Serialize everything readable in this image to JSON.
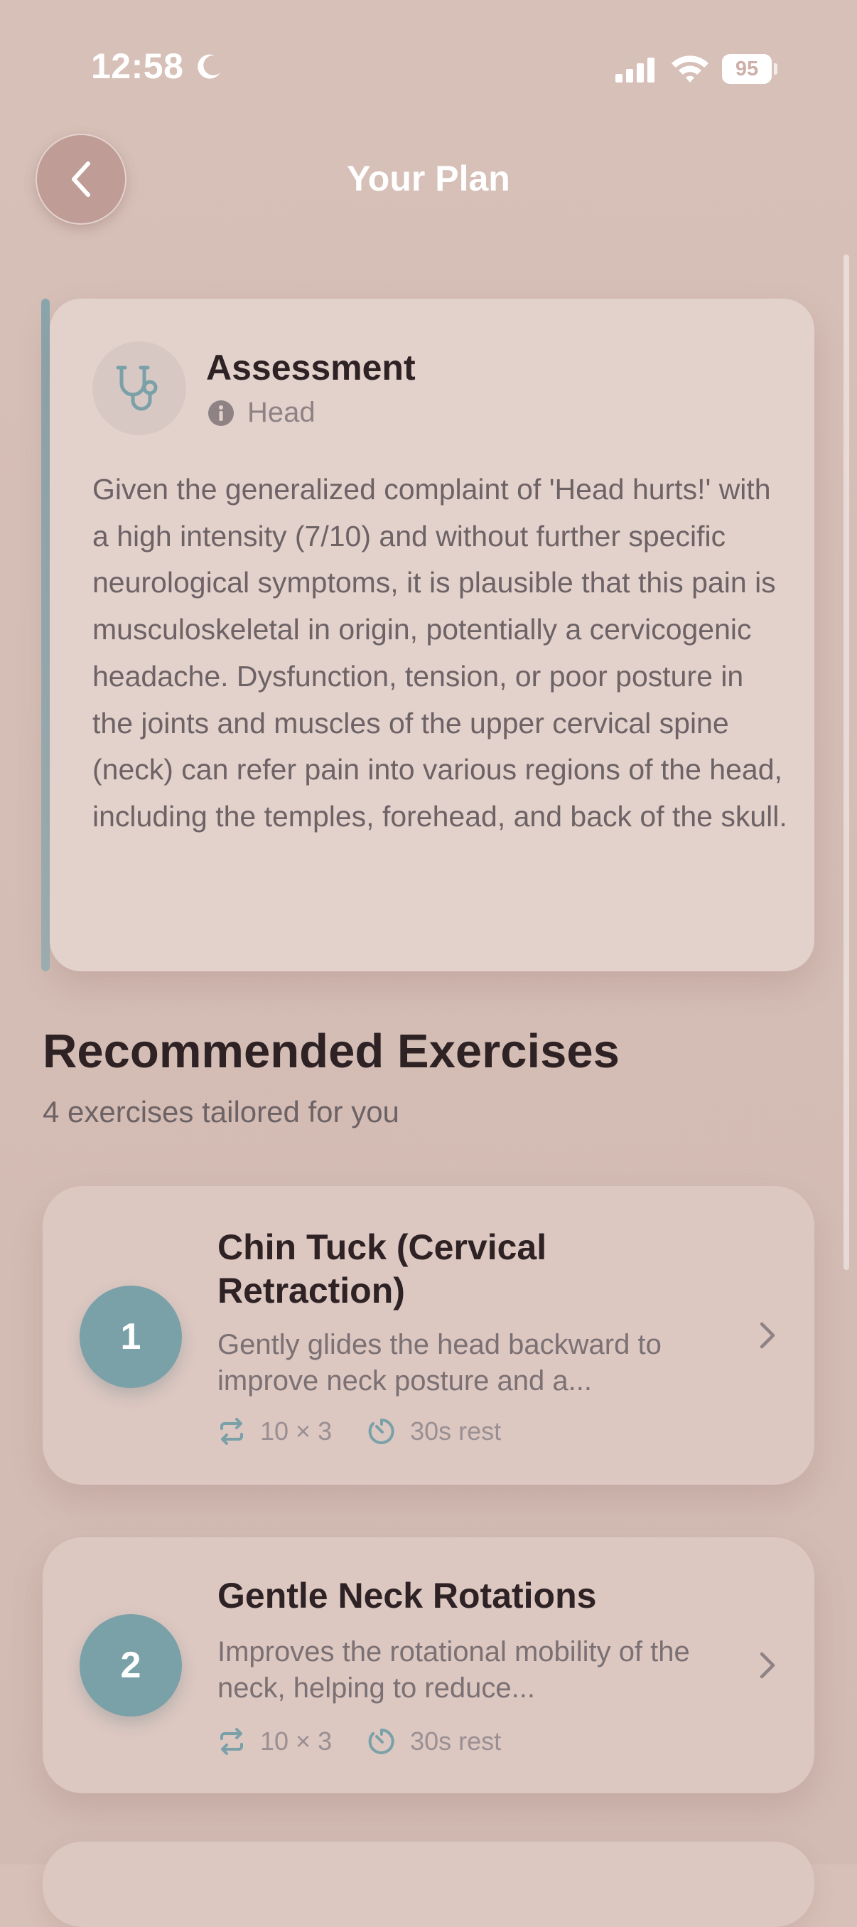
{
  "status": {
    "time": "12:58",
    "battery": "95"
  },
  "header": {
    "title": "Your Plan"
  },
  "assessment": {
    "title": "Assessment",
    "location": "Head",
    "body": "Given the generalized complaint of 'Head hurts!' with a high intensity (7/10) and without further specific neurological symptoms, it is plausible that this pain is musculoskeletal in origin, potentially a cervicogenic headache. Dysfunction, tension, or poor posture in the joints and muscles of the upper cervical spine (neck) can refer pain into various regions of the head, including the temples, forehead, and back of the skull."
  },
  "exercises_section": {
    "title": "Recommended Exercises",
    "subtitle": "4 exercises tailored for you"
  },
  "exercises": [
    {
      "number": "1",
      "title": "Chin Tuck (Cervical Retraction)",
      "description": "Gently glides the head backward to improve neck posture and a...",
      "reps": "10 × 3",
      "rest": "30s rest"
    },
    {
      "number": "2",
      "title": "Gentle Neck Rotations",
      "description": "Improves the rotational mobility of the neck, helping to reduce...",
      "reps": "10 × 3",
      "rest": "30s rest"
    }
  ],
  "colors": {
    "background": "#d6bfb7",
    "accent": "#7aa0a8",
    "card": "#e3d2cc"
  },
  "icons": {
    "back": "chevron-left-icon",
    "assessment": "stethoscope-icon",
    "location": "info-icon",
    "reps": "repeat-icon",
    "rest": "timer-icon",
    "open": "chevron-right-icon"
  }
}
